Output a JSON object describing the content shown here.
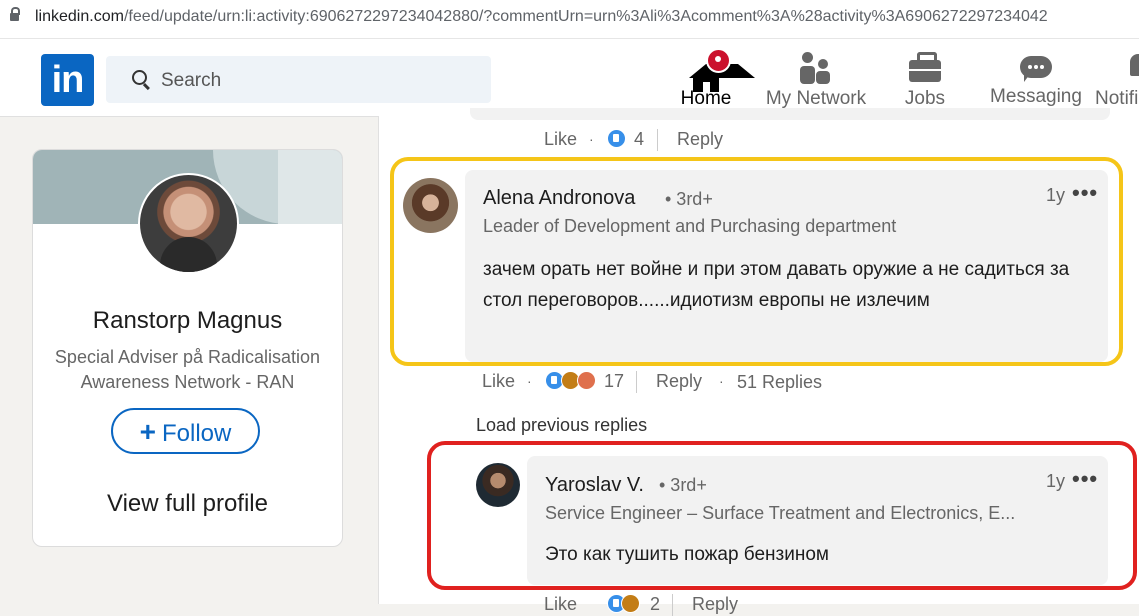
{
  "browser": {
    "url_host": "linkedin.com",
    "url_rest": "/feed/update/urn:li:activity:6906272297234042880/?commentUrn=urn%3Ali%3Acomment%3A%28activity%3A6906272297234042"
  },
  "nav": {
    "logo": "in",
    "search_placeholder": "Search",
    "items": [
      {
        "label": "Home",
        "icon": "home-icon",
        "active": true
      },
      {
        "label": "My Network",
        "icon": "network-icon"
      },
      {
        "label": "Jobs",
        "icon": "briefcase-icon"
      },
      {
        "label": "Messaging",
        "icon": "chat-icon"
      },
      {
        "label": "Notifi",
        "icon": "bell-icon"
      }
    ]
  },
  "profile": {
    "name": "Ranstorp Magnus",
    "headline": "Special Adviser på Radicalisation Awareness Network - RAN",
    "follow_label": "Follow",
    "view_profile_label": "View full profile"
  },
  "prev_comment_actions": {
    "like": "Like",
    "reaction_count": "4",
    "reply": "Reply"
  },
  "comment": {
    "author": "Alena Andronova",
    "degree": "• 3rd+",
    "headline": "Leader of Development and Purchasing department",
    "time": "1y",
    "text": "зачем орать нет войне и при этом давать оружие а не садиться за стол переговоров......идиотизм европы не излечим",
    "like": "Like",
    "reaction_count": "17",
    "reply": "Reply",
    "replies": "51 Replies"
  },
  "load_previous": "Load previous replies",
  "reply_comment": {
    "author": "Yaroslav V.",
    "degree": "• 3rd+",
    "headline": "Service Engineer – Surface Treatment and Electronics, E...",
    "time": "1y",
    "text": "Это как тушить пожар бензином",
    "like": "Like",
    "reaction_count": "2",
    "reply": "Reply"
  },
  "colors": {
    "brand": "#0a66c2",
    "highlight_yellow": "#f5c518",
    "highlight_red": "#e0211f",
    "notification_badge": "#cb112d"
  }
}
